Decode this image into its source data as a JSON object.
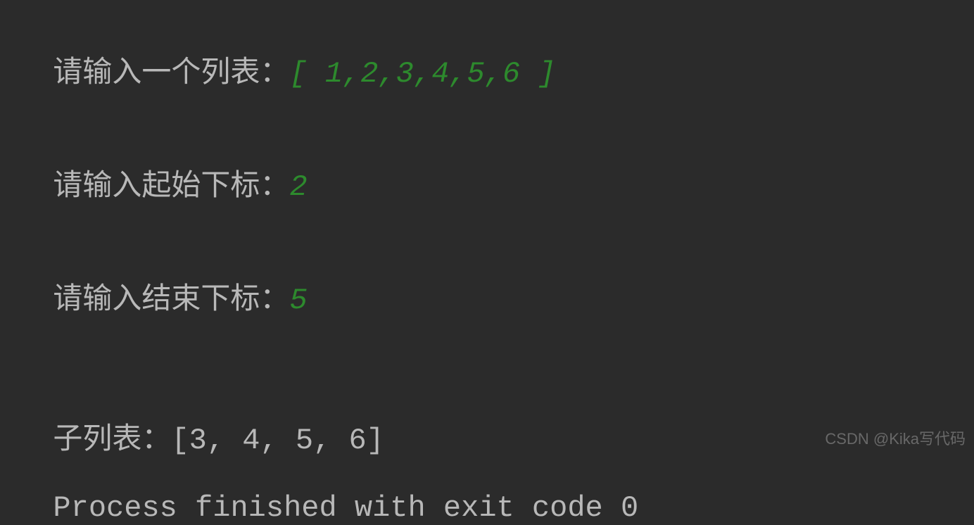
{
  "console": {
    "lines": [
      {
        "prompt": "请输入一个列表：",
        "input": "[ 1,2,3,4,5,6 ]"
      },
      {
        "prompt": "请输入起始下标：",
        "input": "2"
      },
      {
        "prompt": "请输入结束下标：",
        "input": "5"
      },
      {
        "output": "子列表：[3, 4, 5, 6]"
      },
      {
        "output": "Process finished with exit code 0"
      }
    ]
  },
  "watermark": "CSDN @Kika写代码"
}
